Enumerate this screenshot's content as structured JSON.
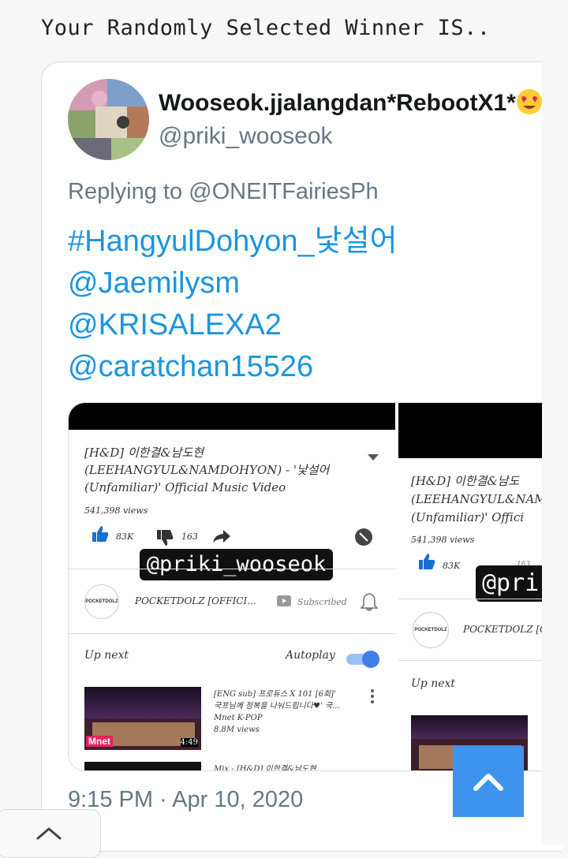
{
  "headline": "Your Randomly Selected Winner IS..",
  "tweet": {
    "display_name": "Wooseok.jjalangdan*RebootX1*",
    "handle": "@priki_wooseok",
    "replying_to": "Replying to @ONEITFairiesPh",
    "lines": [
      "#HangyulDohyon_낯설어",
      "@Jaemilysm",
      "@KRISALEXA2",
      "@caratchan15526"
    ],
    "timestamp": "9:15 PM · Apr 10, 2020"
  },
  "screenshot_left": {
    "video_title": [
      "[H&D] 이한결&남도현",
      "(LEEHANGYUL&NAMDOHYON) - '낯설어",
      "(Unfamiliar)' Official Music Video"
    ],
    "views": "541,398 views",
    "likes": "83K",
    "dislikes": "163",
    "watermark": "@priki_wooseok",
    "channel_logo": "POCKETDOLZ",
    "channel_name": "POCKETDOLZ [OFFICI...",
    "subscribed": "Subscribed",
    "up_next": "Up next",
    "autoplay": "Autoplay",
    "next_title": [
      "[ENG sub] 프로듀스 X 101 [6회]'",
      "국프님께 정복을 나눠드립니다♥' 국..."
    ],
    "next_channel": "Mnet K-POP",
    "next_views": "8.8M views",
    "next_duration": "4:49",
    "next_logo": "Mnet",
    "next2_title": "Mix - [H&D] 이한결&남도현"
  },
  "screenshot_right": {
    "video_title": [
      "[H&D] 이한결&남도",
      "(LEEHANGYUL&NAM",
      "(Unfamiliar)' Offici"
    ],
    "views": "541,398 views",
    "likes": "83K",
    "dislikes": "163",
    "watermark": "@pri",
    "channel_logo": "POCKETDOLZ",
    "channel_name": "POCKETDOLZ [O",
    "up_next": "Up next"
  }
}
